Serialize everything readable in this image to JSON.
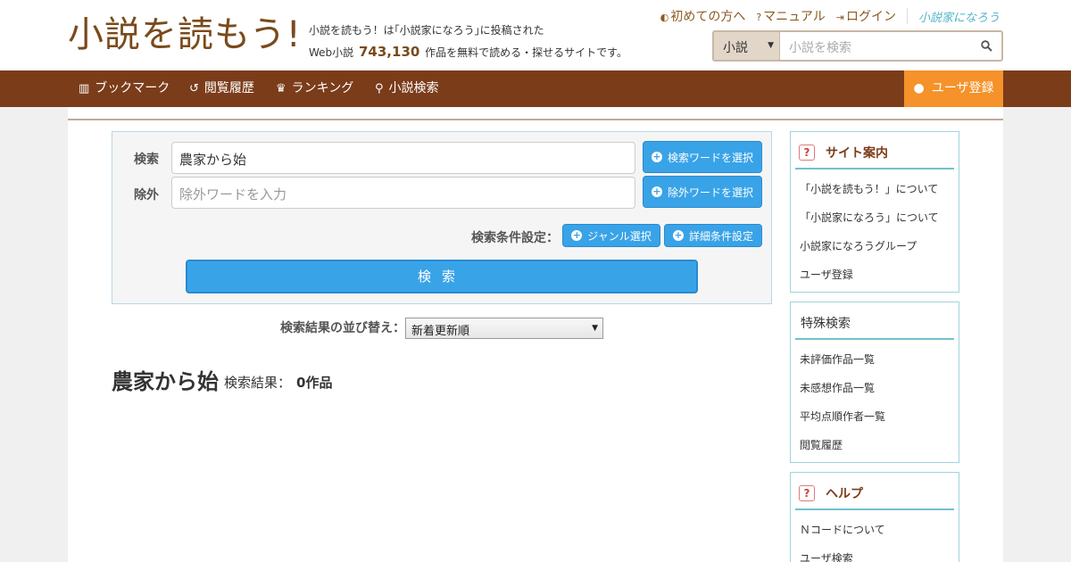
{
  "logo": {
    "text": "小説を読もう!"
  },
  "tagline": {
    "line1": "小説を読もう！は｢小説家になろう｣に投稿された",
    "prefix": "Web小説",
    "count": "743,130",
    "suffix": "作品を無料で読める・探せるサイトです。"
  },
  "toplinks": {
    "first_time": "初めての方へ",
    "manual": "マニュアル",
    "login": "ログイン",
    "naro_logo": "小説家になろう"
  },
  "header_search": {
    "category": "小説",
    "placeholder": "小説を検索"
  },
  "nav": {
    "bookmark": "ブックマーク",
    "history": "閲覧履歴",
    "ranking": "ランキング",
    "search": "小説検索",
    "register": "ユーザ登録"
  },
  "search_panel": {
    "search_label": "検索",
    "search_value": "農家から始",
    "exclude_label": "除外",
    "exclude_placeholder": "除外ワードを入力",
    "select_search_word": "検索ワードを選択",
    "select_exclude_word": "除外ワードを選択",
    "condition_label": "検索条件設定：",
    "genre_select": "ジャンル選択",
    "detail_condition": "詳細条件設定",
    "submit": "検索"
  },
  "sort": {
    "label": "検索結果の並び替え：",
    "selected": "新着更新順"
  },
  "result": {
    "query": "農家から始",
    "label": "検索結果：",
    "count": "0作品"
  },
  "sidebar": {
    "site_guide": {
      "title": "サイト案内",
      "items": [
        "「小説を読もう！」について",
        "「小説家になろう」について",
        "小説家になろうグループ",
        "ユーザ登録"
      ]
    },
    "special_search": {
      "title": "特殊検索",
      "items": [
        "未評価作品一覧",
        "未感想作品一覧",
        "平均点順作者一覧",
        "閲覧履歴"
      ]
    },
    "help": {
      "title": "ヘルプ",
      "items": [
        "Ｎコードについて",
        "ユーザ検索"
      ]
    }
  },
  "colors": {
    "brand_brown": "#7b3c1a",
    "accent_orange": "#f5922a",
    "button_blue": "#39a3e8",
    "sidebar_teal": "#6fc2ce"
  }
}
